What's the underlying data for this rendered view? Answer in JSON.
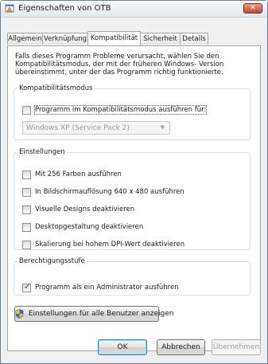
{
  "window": {
    "title": "Eigenschaften von OTB",
    "close_label": "✕"
  },
  "tabs": [
    {
      "label": "Allgemein",
      "active": false
    },
    {
      "label": "Verknüpfung",
      "active": false
    },
    {
      "label": "Kompatibilität",
      "active": true
    },
    {
      "label": "Sicherheit",
      "active": false
    },
    {
      "label": "Details",
      "active": false
    }
  ],
  "description": "Falls dieses Programm Probleme verursacht, wählen Sie den Kompatibilitätsmodus, der mit der früheren Windows- Version übereinstimmt, unter der das Programm richtig funktionierte.",
  "compat_mode": {
    "legend": "Kompatibilitätsmodus",
    "checkbox_label": "Programm im Kompatibilitätsmodus ausführen für:",
    "checked": false,
    "os_select_value": "Windows XP (Service Pack 2)"
  },
  "settings": {
    "legend": "Einstellungen",
    "options": [
      {
        "label": "Mit 256 Farben ausführen",
        "checked": false
      },
      {
        "label": "In Bildschirmauflösung 640 x 480 ausführen",
        "checked": false
      },
      {
        "label": "Visuelle Designs deaktivieren",
        "checked": false
      },
      {
        "label": "Desktopgestaltung deaktivieren",
        "checked": false
      },
      {
        "label": "Skalierung bei hohem DPI-Wert deaktivieren",
        "checked": false
      }
    ]
  },
  "privilege": {
    "legend": "Berechtigungsstufe",
    "checkbox_label": "Programm als ein Administrator ausführen",
    "checked": true
  },
  "all_users_button": "Einstellungen für alle Benutzer anzeigen",
  "buttons": {
    "ok": "OK",
    "cancel": "Abbrechen",
    "apply": "Übernehmen"
  },
  "colors": {
    "shield_blue": "#3a6fc4",
    "shield_yellow": "#f2c12e",
    "checkmark": "#2b3f8a"
  },
  "icons": {
    "title": "properties-window-icon",
    "close": "close-icon",
    "uac": "uac-shield-icon",
    "dropdown": "chevron-down-icon"
  }
}
